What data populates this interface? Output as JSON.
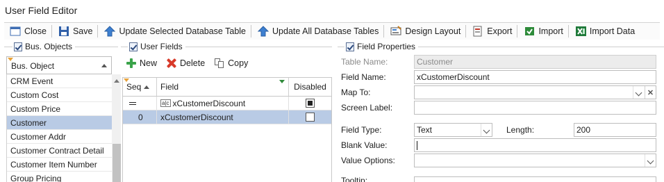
{
  "window": {
    "title": "User Field Editor"
  },
  "toolbar": {
    "close": "Close",
    "save": "Save",
    "update_selected": "Update Selected Database Table",
    "update_all": "Update All Database Tables",
    "design_layout": "Design Layout",
    "export": "Export",
    "import": "Import",
    "import_data": "Import Data"
  },
  "bus_objects": {
    "header": "Bus. Objects",
    "combo_value": "Bus. Object",
    "items": [
      {
        "label": "CRM Event"
      },
      {
        "label": "Custom Cost"
      },
      {
        "label": "Custom Price"
      },
      {
        "label": "Customer",
        "selected": true
      },
      {
        "label": "Customer Addr"
      },
      {
        "label": "Customer Contract Detail"
      },
      {
        "label": "Customer Item Number"
      },
      {
        "label": "Group Pricing"
      }
    ]
  },
  "user_fields": {
    "header": "User Fields",
    "new": "New",
    "delete": "Delete",
    "copy": "Copy",
    "columns": {
      "seq": "Seq",
      "field": "Field",
      "disabled": "Disabled"
    },
    "filter_row": {
      "field": "xCustomerDiscount",
      "disabled": true
    },
    "rows": [
      {
        "seq": "0",
        "field": "xCustomerDiscount",
        "disabled": false
      }
    ]
  },
  "field_properties": {
    "header": "Field Properties",
    "table_name_label": "Table Name:",
    "table_name": "Customer",
    "field_name_label": "Field Name:",
    "field_name": "xCustomerDiscount",
    "map_to_label": "Map To:",
    "map_to": "",
    "screen_label_label": "Screen Label:",
    "screen_label": "",
    "field_type_label": "Field Type:",
    "field_type": "Text",
    "length_label": "Length:",
    "length": "200",
    "blank_value_label": "Blank Value:",
    "blank_value": "",
    "value_options_label": "Value Options:",
    "value_options": "",
    "tooltip_label": "Tooltip:"
  }
}
